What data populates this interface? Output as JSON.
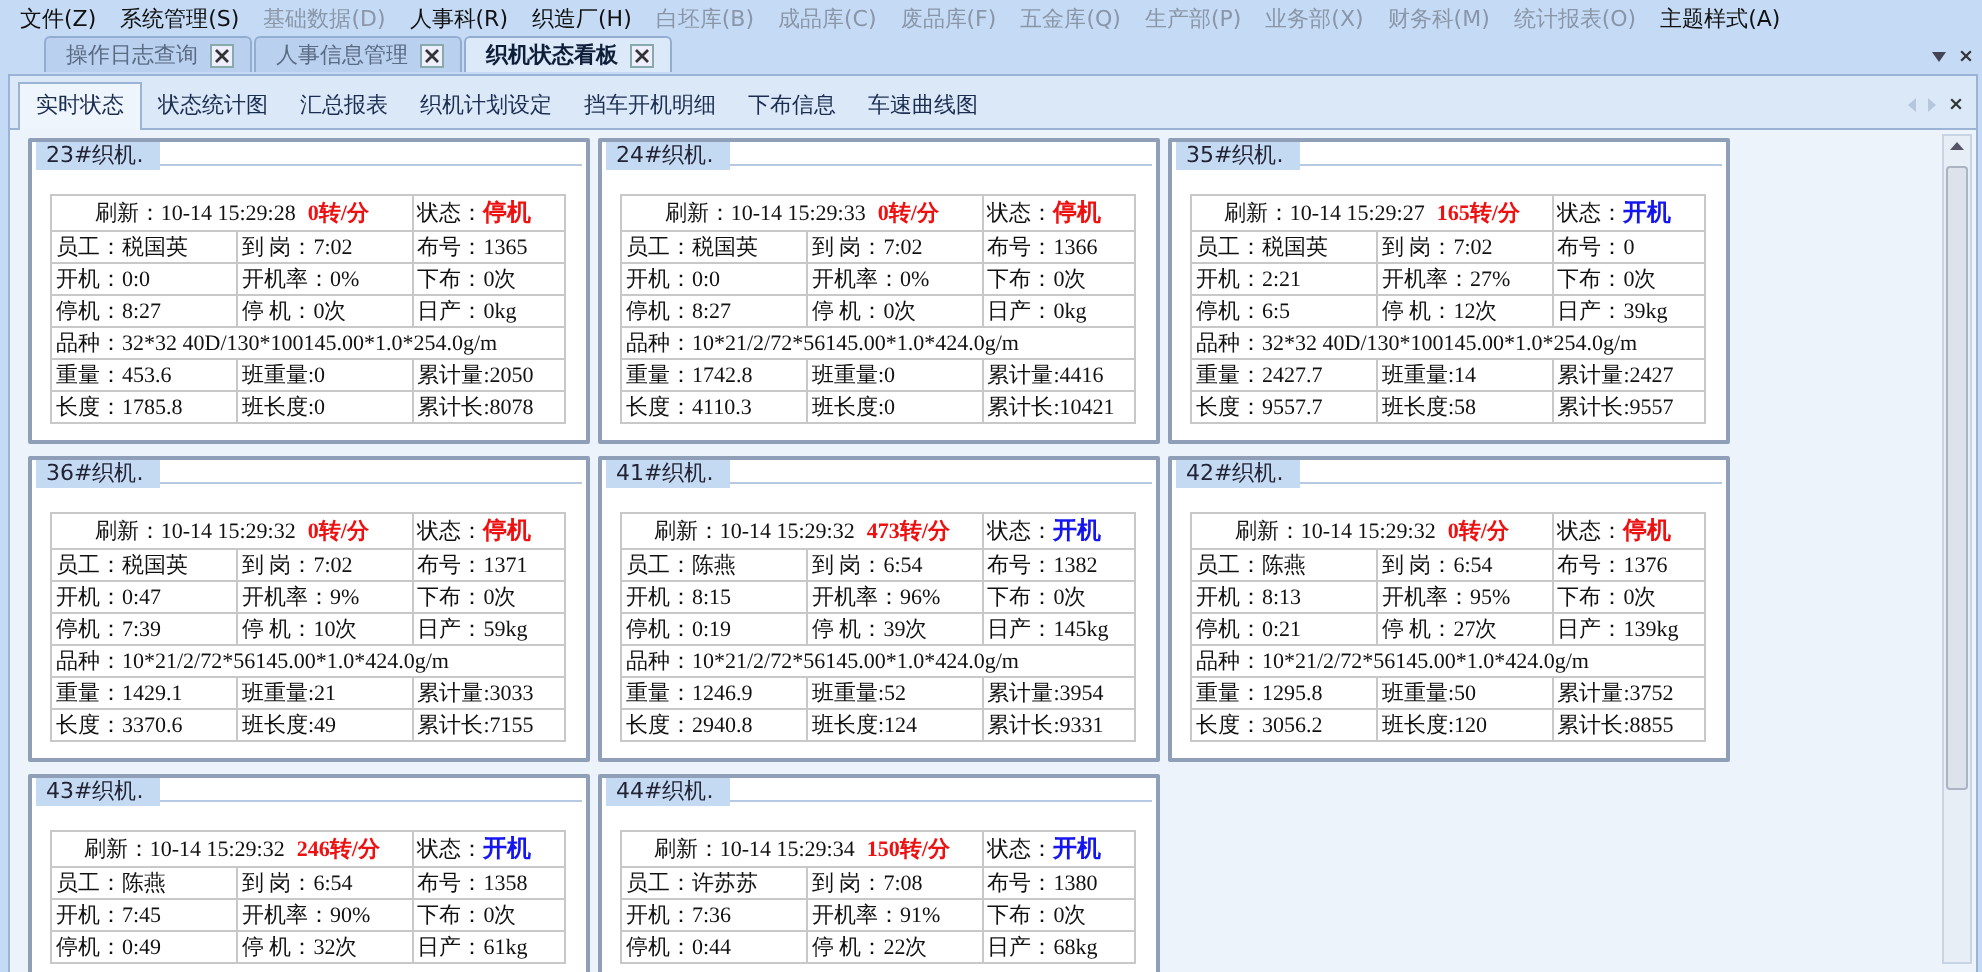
{
  "menu": [
    {
      "label": "文件(Z)",
      "disabled": false
    },
    {
      "label": "系统管理(S)",
      "disabled": false
    },
    {
      "label": "基础数据(D)",
      "disabled": true
    },
    {
      "label": "人事科(R)",
      "disabled": false
    },
    {
      "label": "织造厂(H)",
      "disabled": false
    },
    {
      "label": "白坯库(B)",
      "disabled": true
    },
    {
      "label": "成品库(C)",
      "disabled": true
    },
    {
      "label": "废品库(F)",
      "disabled": true
    },
    {
      "label": "五金库(Q)",
      "disabled": true
    },
    {
      "label": "生产部(P)",
      "disabled": true
    },
    {
      "label": "业务部(X)",
      "disabled": true
    },
    {
      "label": "财务科(M)",
      "disabled": true
    },
    {
      "label": "统计报表(O)",
      "disabled": true
    },
    {
      "label": "主题样式(A)",
      "disabled": false
    }
  ],
  "doc_tabs": [
    {
      "label": "操作日志查询",
      "selected": false
    },
    {
      "label": "人事信息管理",
      "selected": false
    },
    {
      "label": "织机状态看板",
      "selected": true
    }
  ],
  "view_tabs": [
    {
      "label": "实时状态",
      "selected": true
    },
    {
      "label": "状态统计图",
      "selected": false
    },
    {
      "label": "汇总报表",
      "selected": false
    },
    {
      "label": "织机计划设定",
      "selected": false
    },
    {
      "label": "挡车开机明细",
      "selected": false
    },
    {
      "label": "下布信息",
      "selected": false
    },
    {
      "label": "车速曲线图",
      "selected": false
    }
  ],
  "cards": [
    {
      "title": "23#织机.",
      "refresh": "刷新：10-14 15:29:28",
      "speed": "0转/分",
      "status_label": "状态：",
      "status": "停机",
      "running": false,
      "rows": [
        {
          "cells": [
            "员工：税国英",
            "到 岗：7:02",
            "布号：1365"
          ]
        },
        {
          "cells": [
            "开机：0:0",
            "开机率：0%",
            "下布：0次"
          ]
        },
        {
          "cells": [
            "停机：8:27",
            "停 机：0次",
            "日产：0kg"
          ]
        },
        {
          "cells": [
            {
              "text": "品种：32*32 40D/130*100145.00*1.0*254.0g/m",
              "colspan": 3
            }
          ]
        },
        {
          "cells": [
            "重量：453.6",
            "班重量:0",
            "累计量:2050"
          ]
        },
        {
          "cells": [
            "长度：1785.8",
            "班长度:0",
            "累计长:8078"
          ]
        }
      ]
    },
    {
      "title": "24#织机.",
      "refresh": "刷新：10-14 15:29:33",
      "speed": "0转/分",
      "status_label": "状态：",
      "status": "停机",
      "running": false,
      "rows": [
        {
          "cells": [
            "员工：税国英",
            "到 岗：7:02",
            "布号：1366"
          ]
        },
        {
          "cells": [
            "开机：0:0",
            "开机率：0%",
            "下布：0次"
          ]
        },
        {
          "cells": [
            "停机：8:27",
            "停 机：0次",
            "日产：0kg"
          ]
        },
        {
          "cells": [
            {
              "text": "品种：10*21/2/72*56145.00*1.0*424.0g/m",
              "colspan": 3
            }
          ]
        },
        {
          "cells": [
            "重量：1742.8",
            "班重量:0",
            "累计量:4416"
          ]
        },
        {
          "cells": [
            "长度：4110.3",
            "班长度:0",
            "累计长:10421"
          ]
        }
      ]
    },
    {
      "title": "35#织机.",
      "refresh": "刷新：10-14 15:29:27",
      "speed": "165转/分",
      "status_label": "状态：",
      "status": "开机",
      "running": true,
      "rows": [
        {
          "cells": [
            "员工：税国英",
            "到 岗：7:02",
            "布号：0"
          ]
        },
        {
          "cells": [
            "开机：2:21",
            "开机率：27%",
            "下布：0次"
          ]
        },
        {
          "cells": [
            "停机：6:5",
            "停 机：12次",
            "日产：39kg"
          ]
        },
        {
          "cells": [
            {
              "text": "品种：32*32 40D/130*100145.00*1.0*254.0g/m",
              "colspan": 3
            }
          ]
        },
        {
          "cells": [
            "重量：2427.7",
            "班重量:14",
            "累计量:2427"
          ]
        },
        {
          "cells": [
            "长度：9557.7",
            "班长度:58",
            "累计长:9557"
          ]
        }
      ]
    },
    {
      "title": "36#织机.",
      "refresh": "刷新：10-14 15:29:32",
      "speed": "0转/分",
      "status_label": "状态：",
      "status": "停机",
      "running": false,
      "rows": [
        {
          "cells": [
            "员工：税国英",
            "到 岗：7:02",
            "布号：1371"
          ]
        },
        {
          "cells": [
            "开机：0:47",
            "开机率：9%",
            "下布：0次"
          ]
        },
        {
          "cells": [
            "停机：7:39",
            "停 机：10次",
            "日产：59kg"
          ]
        },
        {
          "cells": [
            {
              "text": "品种：10*21/2/72*56145.00*1.0*424.0g/m",
              "colspan": 3
            }
          ]
        },
        {
          "cells": [
            "重量：1429.1",
            "班重量:21",
            "累计量:3033"
          ]
        },
        {
          "cells": [
            "长度：3370.6",
            "班长度:49",
            "累计长:7155"
          ]
        }
      ]
    },
    {
      "title": "41#织机.",
      "refresh": "刷新：10-14 15:29:32",
      "speed": "473转/分",
      "status_label": "状态：",
      "status": "开机",
      "running": true,
      "rows": [
        {
          "cells": [
            "员工：陈燕",
            "到 岗：6:54",
            "布号：1382"
          ]
        },
        {
          "cells": [
            "开机：8:15",
            "开机率：96%",
            "下布：0次"
          ]
        },
        {
          "cells": [
            "停机：0:19",
            "停 机：39次",
            "日产：145kg"
          ]
        },
        {
          "cells": [
            {
              "text": "品种：10*21/2/72*56145.00*1.0*424.0g/m",
              "colspan": 3
            }
          ]
        },
        {
          "cells": [
            "重量：1246.9",
            "班重量:52",
            "累计量:3954"
          ]
        },
        {
          "cells": [
            "长度：2940.8",
            "班长度:124",
            "累计长:9331"
          ]
        }
      ]
    },
    {
      "title": "42#织机.",
      "refresh": "刷新：10-14 15:29:32",
      "speed": "0转/分",
      "status_label": "状态：",
      "status": "停机",
      "running": false,
      "rows": [
        {
          "cells": [
            "员工：陈燕",
            "到 岗：6:54",
            "布号：1376"
          ]
        },
        {
          "cells": [
            "开机：8:13",
            "开机率：95%",
            "下布：0次"
          ]
        },
        {
          "cells": [
            "停机：0:21",
            "停 机：27次",
            "日产：139kg"
          ]
        },
        {
          "cells": [
            {
              "text": "品种：10*21/2/72*56145.00*1.0*424.0g/m",
              "colspan": 3
            }
          ]
        },
        {
          "cells": [
            "重量：1295.8",
            "班重量:50",
            "累计量:3752"
          ]
        },
        {
          "cells": [
            "长度：3056.2",
            "班长度:120",
            "累计长:8855"
          ]
        }
      ]
    },
    {
      "title": "43#织机.",
      "refresh": "刷新：10-14 15:29:32",
      "speed": "246转/分",
      "status_label": "状态：",
      "status": "开机",
      "running": true,
      "rows": [
        {
          "cells": [
            "员工：陈燕",
            "到 岗：6:54",
            "布号：1358"
          ]
        },
        {
          "cells": [
            "开机：7:45",
            "开机率：90%",
            "下布：0次"
          ]
        },
        {
          "cells": [
            "停机：0:49",
            "停 机：32次",
            "日产：61kg"
          ]
        }
      ]
    },
    {
      "title": "44#织机.",
      "refresh": "刷新：10-14 15:29:34",
      "speed": "150转/分",
      "status_label": "状态：",
      "status": "开机",
      "running": true,
      "rows": [
        {
          "cells": [
            "员工：许苏苏",
            "到 岗：7:08",
            "布号：1380"
          ]
        },
        {
          "cells": [
            "开机：7:36",
            "开机率：91%",
            "下布：0次"
          ]
        },
        {
          "cells": [
            "停机：0:44",
            "停 机：22次",
            "日产：68kg"
          ]
        }
      ]
    }
  ]
}
